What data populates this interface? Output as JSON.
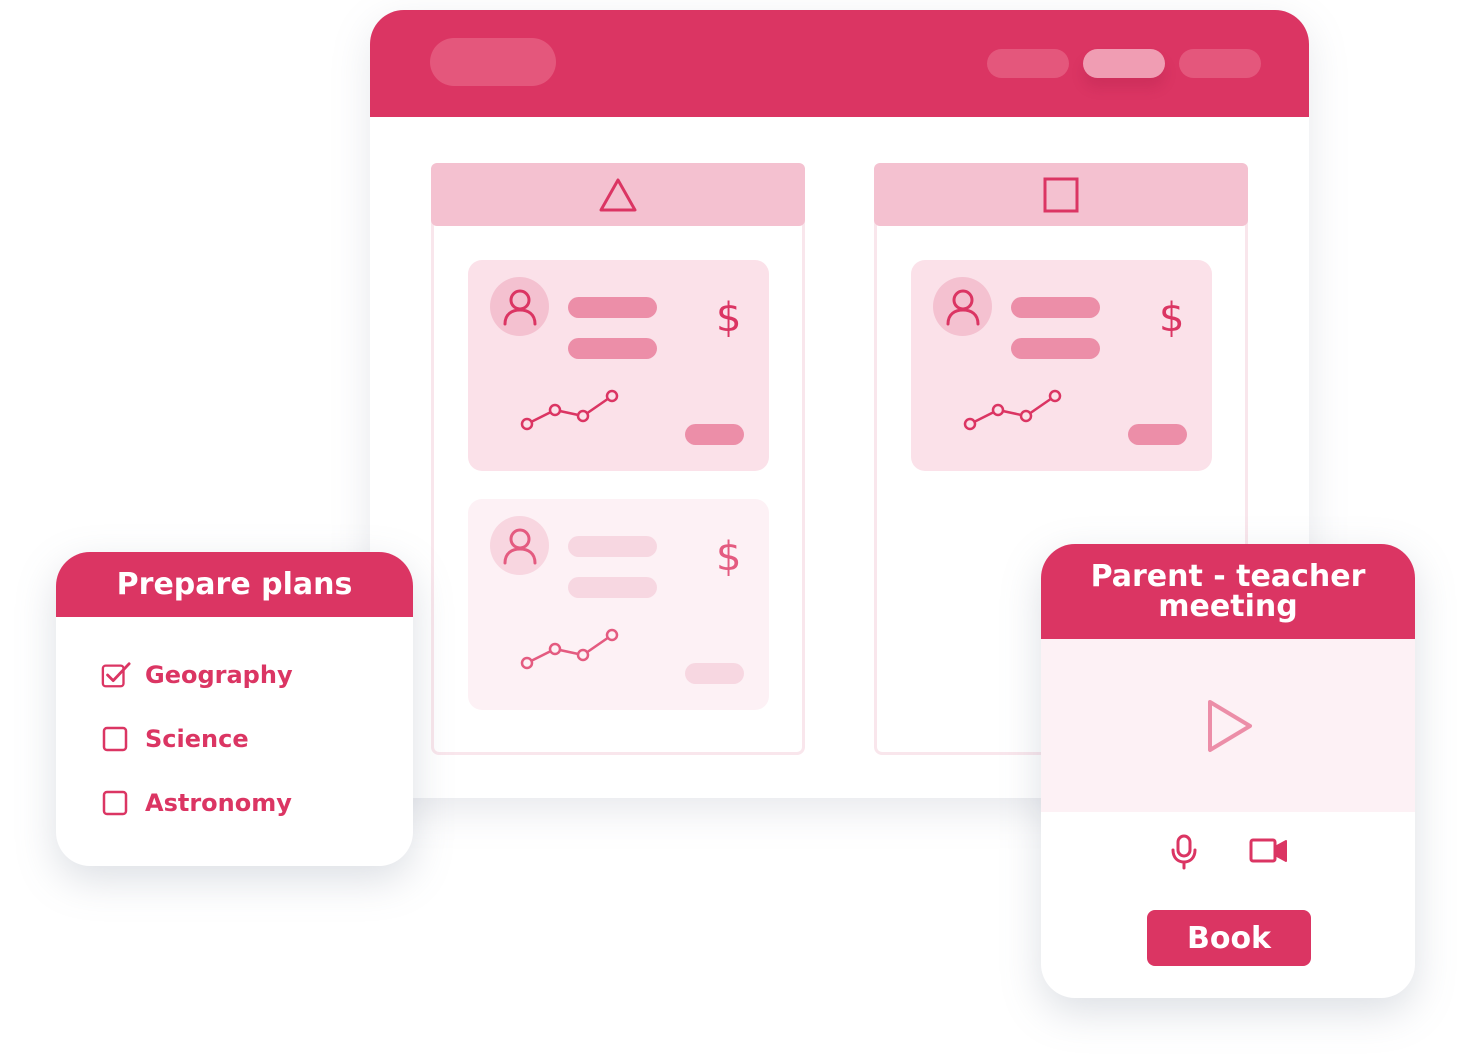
{
  "colors": {
    "accent": "#db3563",
    "accent_light": "#f4c1d0",
    "card_bg": "#fbe1e9",
    "card_bg_faded": "#fdf1f5"
  },
  "window": {
    "columns": [
      {
        "header_icon": "triangle-icon",
        "cards": [
          {
            "icon": "user-icon",
            "currency_symbol": "$",
            "chart_icon": "sparkline-icon",
            "faded": false
          },
          {
            "icon": "user-icon",
            "currency_symbol": "$",
            "chart_icon": "sparkline-icon",
            "faded": true
          }
        ]
      },
      {
        "header_icon": "square-icon",
        "cards": [
          {
            "icon": "user-icon",
            "currency_symbol": "$",
            "chart_icon": "sparkline-icon",
            "faded": false
          }
        ]
      }
    ]
  },
  "plans": {
    "title": "Prepare plans",
    "items": [
      {
        "label": "Geography",
        "checked": true
      },
      {
        "label": "Science",
        "checked": false
      },
      {
        "label": "Astronomy",
        "checked": false
      }
    ]
  },
  "meeting": {
    "title": "Parent - teacher meeting",
    "play_icon": "play-icon",
    "mic_icon": "microphone-icon",
    "camera_icon": "video-camera-icon",
    "book_label": "Book"
  }
}
